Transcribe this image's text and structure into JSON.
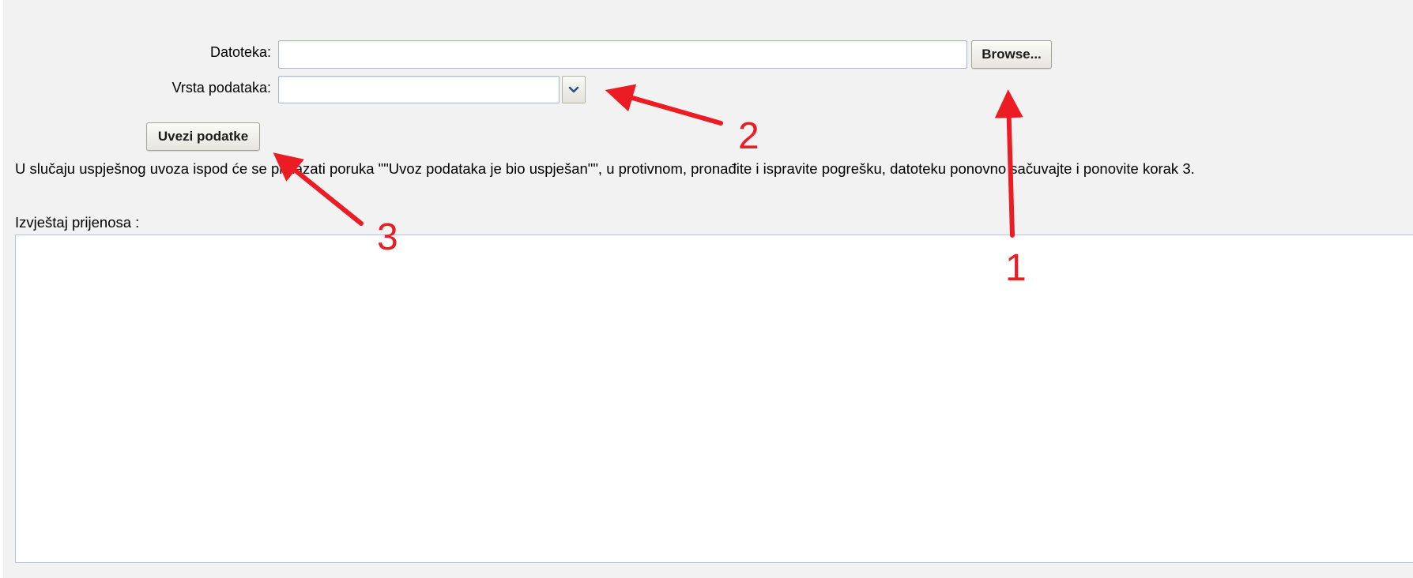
{
  "form": {
    "file_label": "Datoteka:",
    "file_value": "",
    "browse_label": "Browse...",
    "type_label": "Vrsta podataka:",
    "type_value": "",
    "import_label": "Uvezi podatke"
  },
  "info_text": "U slučaju uspješnog uvoza ispod će se prikazati poruka \"\"Uvoz podataka je bio uspješan\"\", u protivnom, pronađite i ispravite pogrešku, datoteku ponovno sačuvajte i ponovite korak 3.",
  "report": {
    "label": "Izvještaj prijenosa :",
    "content": ""
  },
  "annotations": {
    "color": "#ec1c24",
    "numbers": [
      "1",
      "2",
      "3"
    ]
  },
  "icons": {
    "dropdown": "chevron-down-icon"
  }
}
